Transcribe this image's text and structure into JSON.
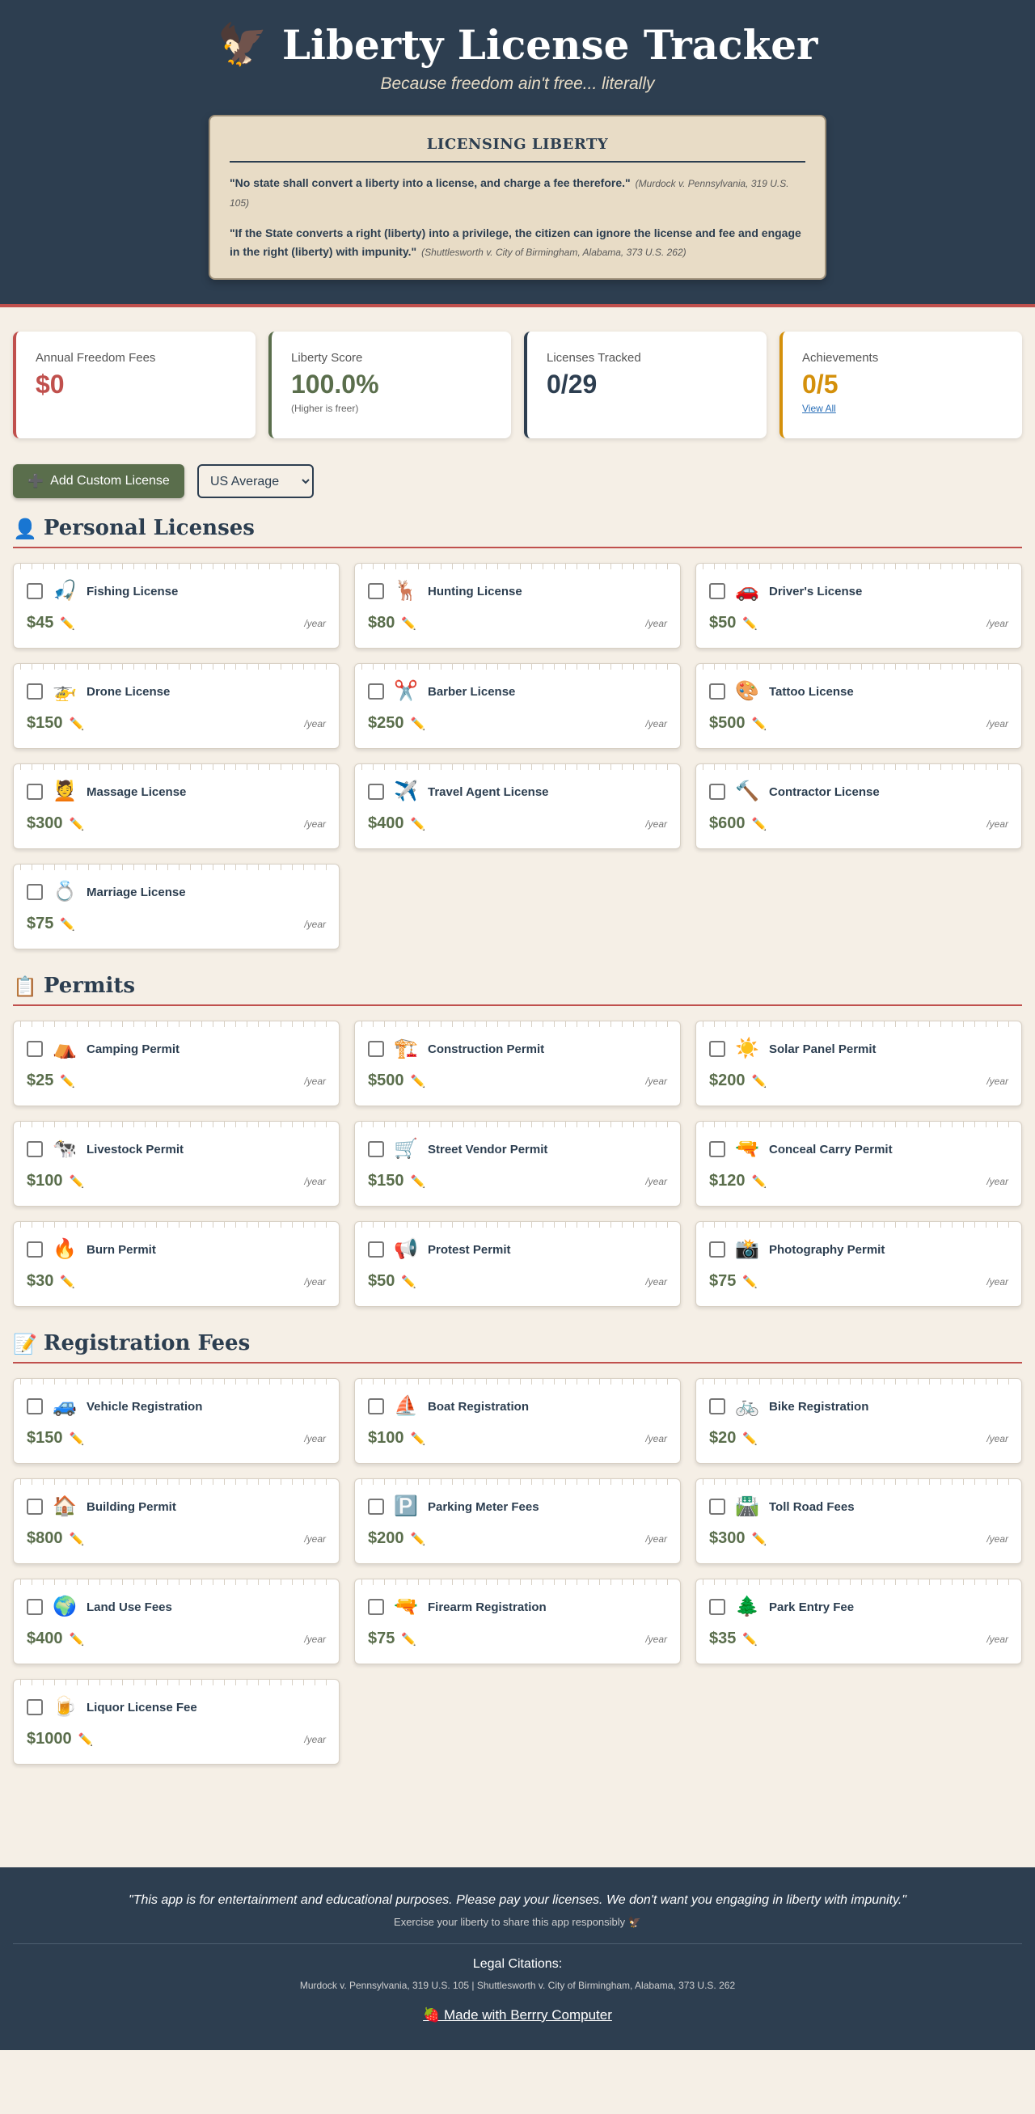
{
  "header": {
    "emoji": "🦅",
    "title": "Liberty License Tracker",
    "subtitle": "Because freedom ain't free... literally"
  },
  "quote_box": {
    "title": "LICENSING LIBERTY",
    "quotes": [
      {
        "text": "\"No state shall convert a liberty into a license, and charge a fee therefore.\"",
        "cite": "(Murdock v. Pennsylvania, 319 U.S. 105)"
      },
      {
        "text": "\"If the State converts a right (liberty) into a privilege, the citizen can ignore the license and fee and engage in the right (liberty) with impunity.\"",
        "cite": "(Shuttlesworth v. City of Birmingham, Alabama, 373 U.S. 262)"
      }
    ]
  },
  "stats": {
    "fees": {
      "label": "Annual Freedom Fees",
      "value": "$0"
    },
    "score": {
      "label": "Liberty Score",
      "value": "100.0%",
      "note": "(Higher is freer)"
    },
    "tracked": {
      "label": "Licenses Tracked",
      "value": "0/29"
    },
    "achievements": {
      "label": "Achievements",
      "value": "0/5",
      "link": "View All"
    }
  },
  "controls": {
    "add_icon": "➕",
    "add_label": "Add Custom License",
    "region_options": [
      "US Average"
    ],
    "region_selected": "US Average"
  },
  "per_label": "/year",
  "edit_icon": "✏️",
  "sections": {
    "personal": {
      "icon": "👤",
      "title": "Personal Licenses",
      "items": [
        {
          "emoji": "🎣",
          "name": "Fishing License",
          "price": "$45"
        },
        {
          "emoji": "🦌",
          "name": "Hunting License",
          "price": "$80"
        },
        {
          "emoji": "🚗",
          "name": "Driver's License",
          "price": "$50"
        },
        {
          "emoji": "🚁",
          "name": "Drone License",
          "price": "$150"
        },
        {
          "emoji": "✂️",
          "name": "Barber License",
          "price": "$250"
        },
        {
          "emoji": "🎨",
          "name": "Tattoo License",
          "price": "$500"
        },
        {
          "emoji": "💆",
          "name": "Massage License",
          "price": "$300"
        },
        {
          "emoji": "✈️",
          "name": "Travel Agent License",
          "price": "$400"
        },
        {
          "emoji": "🔨",
          "name": "Contractor License",
          "price": "$600"
        },
        {
          "emoji": "💍",
          "name": "Marriage License",
          "price": "$75"
        }
      ]
    },
    "permits": {
      "icon": "📋",
      "title": "Permits",
      "items": [
        {
          "emoji": "⛺",
          "name": "Camping Permit",
          "price": "$25"
        },
        {
          "emoji": "🏗️",
          "name": "Construction Permit",
          "price": "$500"
        },
        {
          "emoji": "☀️",
          "name": "Solar Panel Permit",
          "price": "$200"
        },
        {
          "emoji": "🐄",
          "name": "Livestock Permit",
          "price": "$100"
        },
        {
          "emoji": "🛒",
          "name": "Street Vendor Permit",
          "price": "$150"
        },
        {
          "emoji": "🔫",
          "name": "Conceal Carry Permit",
          "price": "$120"
        },
        {
          "emoji": "🔥",
          "name": "Burn Permit",
          "price": "$30"
        },
        {
          "emoji": "📢",
          "name": "Protest Permit",
          "price": "$50"
        },
        {
          "emoji": "📸",
          "name": "Photography Permit",
          "price": "$75"
        }
      ]
    },
    "registration": {
      "icon": "📝",
      "title": "Registration Fees",
      "items": [
        {
          "emoji": "🚙",
          "name": "Vehicle Registration",
          "price": "$150"
        },
        {
          "emoji": "⛵",
          "name": "Boat Registration",
          "price": "$100"
        },
        {
          "emoji": "🚲",
          "name": "Bike Registration",
          "price": "$20"
        },
        {
          "emoji": "🏠",
          "name": "Building Permit",
          "price": "$800"
        },
        {
          "emoji": "🅿️",
          "name": "Parking Meter Fees",
          "price": "$200"
        },
        {
          "emoji": "🛣️",
          "name": "Toll Road Fees",
          "price": "$300"
        },
        {
          "emoji": "🌍",
          "name": "Land Use Fees",
          "price": "$400"
        },
        {
          "emoji": "🔫",
          "name": "Firearm Registration",
          "price": "$75"
        },
        {
          "emoji": "🌲",
          "name": "Park Entry Fee",
          "price": "$35"
        },
        {
          "emoji": "🍺",
          "name": "Liquor License Fee",
          "price": "$1000"
        }
      ]
    }
  },
  "footer": {
    "quote": "\"This app is for entertainment and educational purposes. Please pay your licenses. We don't want you engaging in liberty with impunity.\"",
    "share": "Exercise your liberty to share this app responsibly 🦅",
    "citations_title": "Legal Citations:",
    "citations": "Murdock v. Pennsylvania, 319 U.S. 105 | Shuttlesworth v. City of Birmingham, Alabama, 373 U.S. 262",
    "made_with": "🍓 Made with Berrry Computer"
  },
  "colors": {
    "navy": "#2d3e50",
    "red": "#c0504d",
    "green": "#5a6e4c",
    "gold": "#d4900b",
    "cream": "#f5efe6",
    "parchment": "#e8dcc6"
  }
}
